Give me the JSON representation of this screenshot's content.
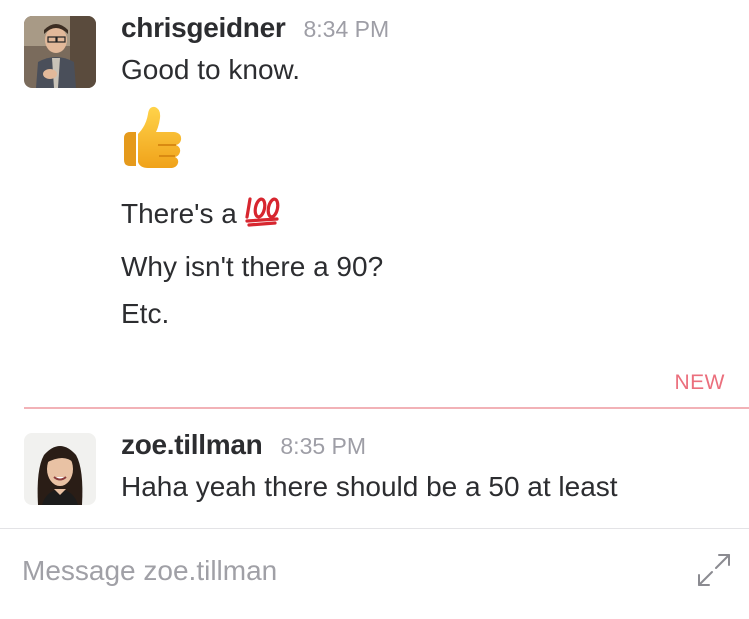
{
  "messages": [
    {
      "sender": "chrisgeidner",
      "time": "8:34 PM",
      "avatar_icon": "user-photo-chrisgeidner",
      "lines": {
        "l1": "Good to know.",
        "emoji": "thumbs-up-emoji",
        "l2_text": "There's a",
        "l2_emoji": "hundred-points-emoji",
        "l3": "Why isn't there a 90?",
        "l4": "Etc."
      }
    },
    {
      "sender": "zoe.tillman",
      "time": "8:35 PM",
      "avatar_icon": "user-photo-zoe-tillman",
      "lines": {
        "l1": "Haha yeah there should be a 50 at least"
      }
    }
  ],
  "new_divider": {
    "label": "NEW",
    "color": "#eb6f7d"
  },
  "composer": {
    "placeholder": "Message zoe.tillman",
    "value": "",
    "expand_icon": "expand-arrows-icon"
  }
}
